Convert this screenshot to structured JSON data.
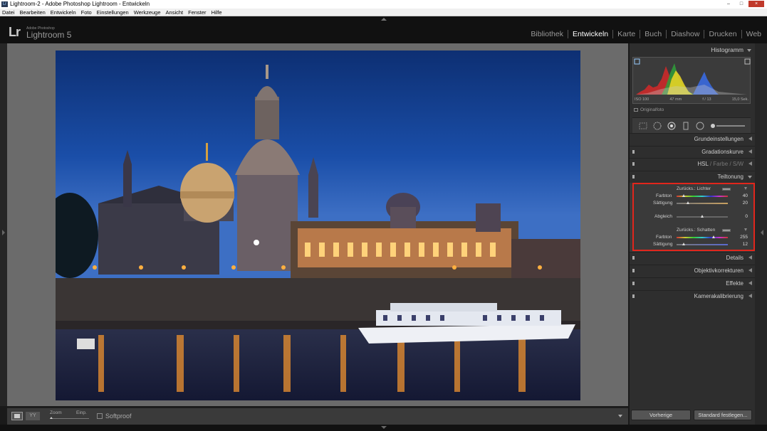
{
  "window": {
    "title": "Lightroom-2 - Adobe Photoshop Lightroom - Entwickeln",
    "app_icon": "Lr",
    "controls": [
      "–",
      "□",
      "×"
    ]
  },
  "menu": [
    "Datei",
    "Bearbeiten",
    "Entwickeln",
    "Foto",
    "Einstellungen",
    "Werkzeuge",
    "Ansicht",
    "Fenster",
    "Hilfe"
  ],
  "identity": {
    "mark": "Lr",
    "subtitle": "Adobe Photoshop",
    "name": "Lightroom 5"
  },
  "modules": [
    {
      "label": "Bibliothek",
      "active": false
    },
    {
      "label": "Entwickeln",
      "active": true
    },
    {
      "label": "Karte",
      "active": false
    },
    {
      "label": "Buch",
      "active": false
    },
    {
      "label": "Diashow",
      "active": false
    },
    {
      "label": "Drucken",
      "active": false
    },
    {
      "label": "Web",
      "active": false
    }
  ],
  "toolbar": {
    "view_mode": "YY",
    "zoom_label": "Zoom",
    "fit_label": "Einp.",
    "softproof_label": "Softproof"
  },
  "panel": {
    "histogram": {
      "title": "Histogramm",
      "iso": "ISO 100",
      "focal": "47 mm",
      "aperture": "f / 13",
      "exposure": "15,0 Sek.",
      "original_label": "Originalfoto"
    },
    "sections": {
      "basic": "Grundeinstellungen",
      "curve": "Gradationskurve",
      "hsl": "HSL",
      "color": "Farbe",
      "bw": "S/W",
      "split": "Teiltonung",
      "details": "Details",
      "lens": "Objektivkorrekturen",
      "effects": "Effekte",
      "calib": "Kamerakalibrierung"
    },
    "split_toning": {
      "highlights_label": "Zurücks.: Lichter",
      "hue_label": "Farbton",
      "saturation_label": "Sättigung",
      "balance_label": "Abgleich",
      "shadows_label": "Zurücks.: Schatten",
      "highlights_hue": "40",
      "highlights_saturation": "20",
      "balance": "0",
      "shadows_hue": "255",
      "shadows_saturation": "12",
      "highlights_hue_value": 40,
      "highlights_saturation_value": 20,
      "balance_value": 0,
      "shadows_hue_value": 255,
      "shadows_saturation_value": 12
    },
    "buttons": {
      "previous": "Vorherige",
      "reset": "Standard festlegen..."
    }
  },
  "colors": {
    "highlight_frame": "#e1261c",
    "panel_bg": "#2e2e2e",
    "canvas_bg": "#6b6b6b"
  },
  "icons": [
    "crop-icon",
    "spot-removal-icon",
    "red-eye-icon",
    "graduated-filter-icon",
    "radial-filter-icon",
    "adjustment-brush-icon"
  ]
}
